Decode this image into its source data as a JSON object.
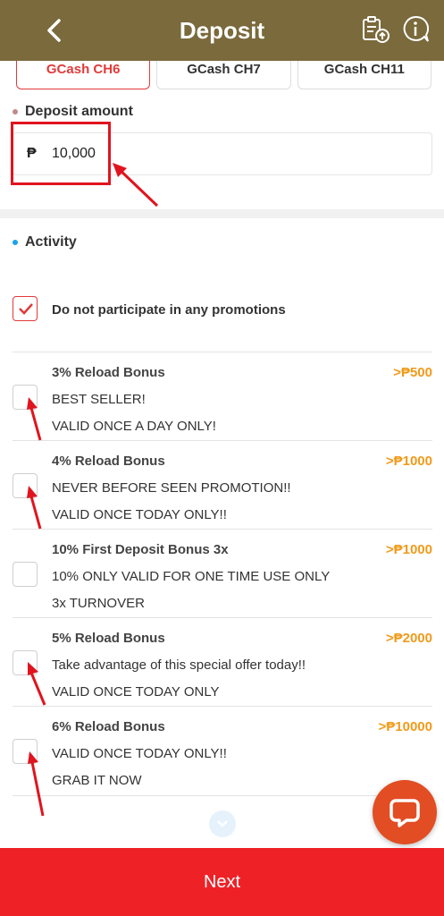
{
  "header": {
    "title": "Deposit",
    "back_icon": "chevron-left-icon",
    "history_icon": "clipboard-upload-icon",
    "info_icon": "info-icon"
  },
  "channels": [
    {
      "label": "GCash CH6",
      "active": true
    },
    {
      "label": "GCash CH7",
      "active": false
    },
    {
      "label": "GCash CH11",
      "active": false
    }
  ],
  "deposit": {
    "label": "Deposit amount",
    "currency_symbol": "₱",
    "amount": "10,000",
    "dot_color": "#c08a8a"
  },
  "activity": {
    "label": "Activity",
    "dot_color": "#1aa3e8",
    "no_promo_label": "Do not participate in any promotions",
    "no_promo_checked": true,
    "promotions": [
      {
        "title": "3% Reload Bonus",
        "min": ">₱500",
        "line1": "BEST SELLER!",
        "line2": "VALID ONCE A DAY ONLY!",
        "checked": false
      },
      {
        "title": "4% Reload Bonus",
        "min": ">₱1000",
        "line1": "NEVER BEFORE SEEN PROMOTION!!",
        "line2": "VALID ONCE TODAY ONLY!!",
        "checked": false
      },
      {
        "title": "10% First Deposit Bonus 3x",
        "min": ">₱1000",
        "line1": "10% ONLY VALID FOR ONE TIME USE ONLY",
        "line2": "3x TURNOVER",
        "checked": false
      },
      {
        "title": "5% Reload Bonus",
        "min": ">₱2000",
        "line1": "Take advantage of this special offer today!!",
        "line2": "VALID ONCE TODAY ONLY",
        "checked": false
      },
      {
        "title": "6% Reload Bonus",
        "min": ">₱10000",
        "line1": "VALID ONCE TODAY ONLY!!",
        "line2": "GRAB IT NOW",
        "checked": false
      }
    ]
  },
  "footer": {
    "next_label": "Next"
  },
  "colors": {
    "header_bg": "#7a6a3c",
    "accent_red": "#ee2127",
    "min_amount": "#f09a1a",
    "chat_bg": "#e24d23"
  }
}
